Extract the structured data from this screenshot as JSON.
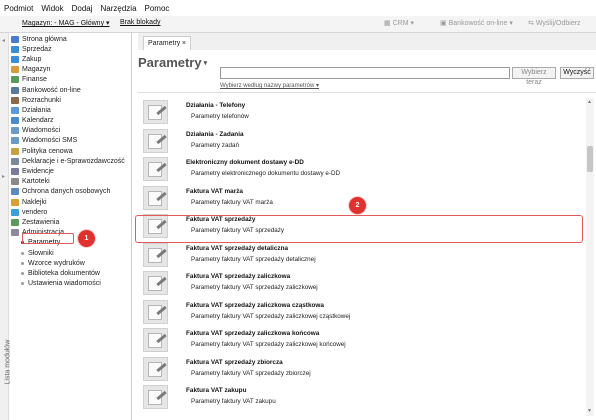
{
  "menubar": [
    "Podmiot",
    "Widok",
    "Dodaj",
    "Narzędzia",
    "Pomoc"
  ],
  "toolbar": {
    "warehouse": "Magazyn: - MAG - Główny ▾",
    "blockade": "Brak blokady",
    "crm": "CRM ▾",
    "bank": "Bankowość on-line ▾",
    "send": "Wyślij/Odbierz"
  },
  "sidebar": {
    "vertical_label": "Lista modułów",
    "items": [
      {
        "label": "Strona główna",
        "icon": "home-icon",
        "color": "#4a7bd0"
      },
      {
        "label": "Sprzedaż",
        "icon": "sales-icon",
        "color": "#3a8ed8"
      },
      {
        "label": "Zakup",
        "icon": "purchase-icon",
        "color": "#3a8ed8"
      },
      {
        "label": "Magazyn",
        "icon": "warehouse-icon",
        "color": "#d89b3a"
      },
      {
        "label": "Finanse",
        "icon": "finance-icon",
        "color": "#5a9a5a"
      },
      {
        "label": "Bankowość on-line",
        "icon": "bank-icon",
        "color": "#5a7a9a"
      },
      {
        "label": "Rozrachunki",
        "icon": "settlements-icon",
        "color": "#8a6a4a"
      },
      {
        "label": "Działania",
        "icon": "actions-icon",
        "color": "#5a9ad8"
      },
      {
        "label": "Kalendarz",
        "icon": "calendar-icon",
        "color": "#4a8ad0"
      },
      {
        "label": "Wiadomości",
        "icon": "messages-icon",
        "color": "#6a9ac8"
      },
      {
        "label": "Wiadomości SMS",
        "icon": "sms-icon",
        "color": "#6a9ac8"
      },
      {
        "label": "Polityka cenowa",
        "icon": "pricing-icon",
        "color": "#c8a040"
      },
      {
        "label": "Deklaracje i e-Sprawozdawczość",
        "icon": "declarations-icon",
        "color": "#7a8a9a"
      },
      {
        "label": "Ewidencje",
        "icon": "registers-icon",
        "color": "#7a7a9a"
      },
      {
        "label": "Kartoteki",
        "icon": "files-icon",
        "color": "#8a8a8a"
      },
      {
        "label": "Ochrona danych osobowych",
        "icon": "data-protection-icon",
        "color": "#5a8ac0"
      },
      {
        "label": "Naklejki",
        "icon": "stickers-icon",
        "color": "#d8a030"
      },
      {
        "label": "vendero",
        "icon": "vendero-icon",
        "color": "#3aa0d8"
      },
      {
        "label": "Zestawienia",
        "icon": "reports-icon",
        "color": "#5a9a5a"
      },
      {
        "label": "Administracja",
        "icon": "admin-icon",
        "color": "#8a8a9a"
      }
    ],
    "subitems": [
      "Parametry",
      "Słowniki",
      "Wzorce wydruków",
      "Biblioteka dokumentów",
      "Ustawienia wiadomości"
    ]
  },
  "tab": {
    "label": "Parametry",
    "close": "×"
  },
  "main": {
    "title": "Parametry",
    "search_placeholder": "",
    "search_button": "Wybierz teraz",
    "clear_button": "Wyczyść",
    "search_hint": "Wybierz według nazwy parametrów ▾"
  },
  "rows": [
    {
      "title": "Działania - Telefony",
      "desc": "Parametry telefonów"
    },
    {
      "title": "Działania - Zadania",
      "desc": "Parametry zadań"
    },
    {
      "title": "Elektroniczny dokument dostawy e-DD",
      "desc": "Parametry elektronicznego dokumentu dostawy e-DD"
    },
    {
      "title": "Faktura VAT marża",
      "desc": "Parametry faktury VAT marża"
    },
    {
      "title": "Faktura VAT sprzedaży",
      "desc": "Parametry faktury VAT sprzedaży"
    },
    {
      "title": "Faktura VAT sprzedaży detaliczna",
      "desc": "Parametry faktury VAT sprzedaży detalicznej"
    },
    {
      "title": "Faktura VAT sprzedaży zaliczkowa",
      "desc": "Parametry faktury VAT sprzedaży zaliczkowej"
    },
    {
      "title": "Faktura VAT sprzedaży zaliczkowa cząstkowa",
      "desc": "Parametry faktury VAT sprzedaży zaliczkowej cząstkowej"
    },
    {
      "title": "Faktura VAT sprzedaży zaliczkowa końcowa",
      "desc": "Parametry faktury VAT sprzedaży zaliczkowej końcowej"
    },
    {
      "title": "Faktura VAT sprzedaży zbiorcza",
      "desc": "Parametry faktury VAT sprzedaży zbiorczej"
    },
    {
      "title": "Faktura VAT zakupu",
      "desc": "Parametry faktury VAT zakupu"
    }
  ],
  "badges": [
    "1",
    "2"
  ],
  "colors": {
    "highlight": "#e35a5a",
    "badge": "#e03131"
  }
}
